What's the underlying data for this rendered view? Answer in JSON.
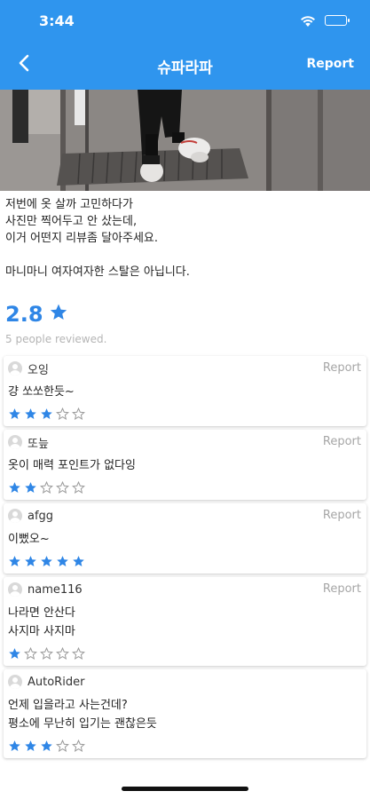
{
  "status_bar": {
    "time": "3:44"
  },
  "nav": {
    "title": "슈파라파",
    "report_label": "Report"
  },
  "post": {
    "description_lines": [
      "저번에 옷 살까 고민하다가\n사진만 찍어두고 안 샀는데,\n이거 어떤지 리뷰좀 달아주세요.",
      "마니마니 여자여자한 스탈은 아닙니다."
    ],
    "rating": "2.8",
    "review_count_text": "5 people reviewed."
  },
  "reviews": [
    {
      "name": "오잉",
      "text": "걍 쏘쏘한듯~",
      "stars": 3,
      "report_label": "Report"
    },
    {
      "name": "또늪",
      "text": "옷이 매력 포인트가 없다잉",
      "stars": 2,
      "report_label": "Report"
    },
    {
      "name": "afgg",
      "text": "이뻤오~",
      "stars": 5,
      "report_label": "Report"
    },
    {
      "name": "name116",
      "text": "나라면 안산다\n사지마 사지마",
      "stars": 1,
      "report_label": "Report"
    },
    {
      "name": "AutoRider",
      "text": "언제 입을라고 사는건데?\n평소에 무난히 입기는 괜찮은듯",
      "stars": 3,
      "report_label": ""
    }
  ],
  "colors": {
    "header": "#2f95ee",
    "accent": "#2f86e6",
    "star_empty_outline": "#9a9a9a"
  },
  "icons": {
    "back": "chevron-left-icon",
    "star": "star-icon",
    "avatar": "user-avatar-icon"
  }
}
